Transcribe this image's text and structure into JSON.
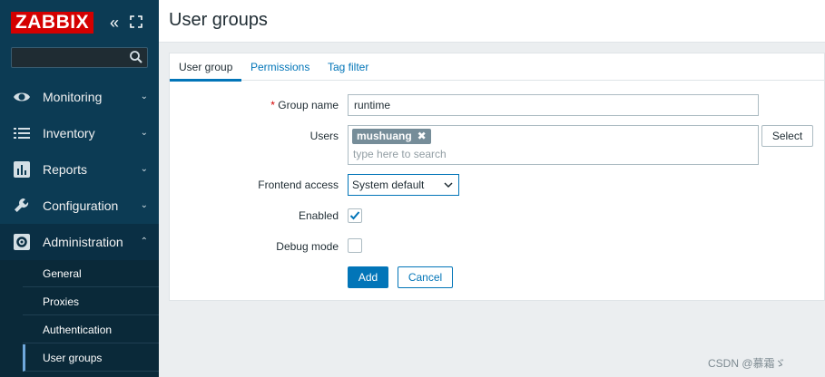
{
  "app": {
    "logo": "ZABBIX"
  },
  "sidebar": {
    "search_placeholder": "",
    "menu": [
      {
        "label": "Monitoring",
        "icon": "eye-icon"
      },
      {
        "label": "Inventory",
        "icon": "list-icon"
      },
      {
        "label": "Reports",
        "icon": "bar-chart-icon"
      },
      {
        "label": "Configuration",
        "icon": "wrench-icon"
      },
      {
        "label": "Administration",
        "icon": "gear-icon",
        "expanded": true
      }
    ],
    "submenu": [
      {
        "label": "General"
      },
      {
        "label": "Proxies"
      },
      {
        "label": "Authentication"
      },
      {
        "label": "User groups",
        "active": true
      }
    ]
  },
  "header": {
    "title": "User groups"
  },
  "tabs": [
    {
      "label": "User group",
      "active": true
    },
    {
      "label": "Permissions"
    },
    {
      "label": "Tag filter"
    }
  ],
  "form": {
    "group_name": {
      "label": "Group name",
      "value": "runtime"
    },
    "users": {
      "label": "Users",
      "tags": [
        "mushuang"
      ],
      "placeholder": "type here to search",
      "select_label": "Select"
    },
    "frontend_access": {
      "label": "Frontend access",
      "value": "System default"
    },
    "enabled": {
      "label": "Enabled",
      "checked": true
    },
    "debug_mode": {
      "label": "Debug mode",
      "checked": false
    },
    "add_label": "Add",
    "cancel_label": "Cancel"
  },
  "watermark": "CSDN @慕霜ゞ",
  "colors": {
    "sidebar": "#0c3b54",
    "accent": "#0275b8",
    "logo": "#d40000"
  }
}
